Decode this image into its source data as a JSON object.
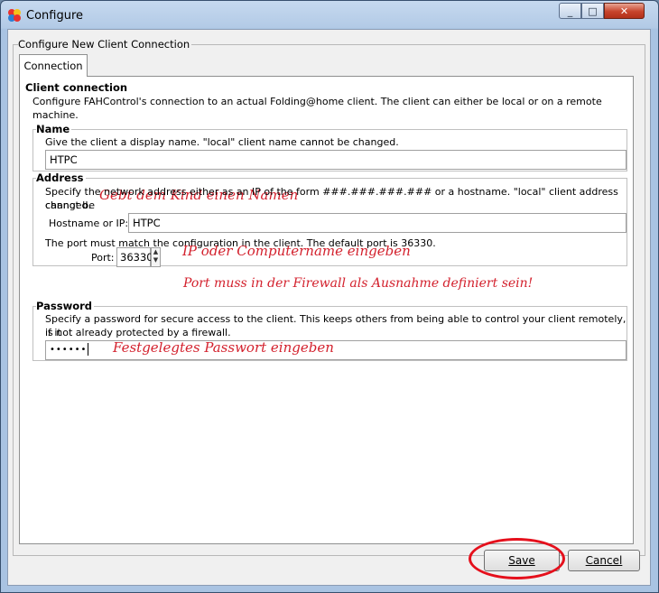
{
  "window": {
    "title": "Configure",
    "min_icon": "_",
    "max_icon": "□",
    "close_icon": "✕"
  },
  "group_title": "Configure New Client Connection",
  "tab": {
    "label": "Connection"
  },
  "client_connection": {
    "title": "Client connection",
    "desc_line1": "Configure FAHControl's connection to an actual Folding@home client.  The client can either be local or on a remote",
    "desc_line2": "machine."
  },
  "name_section": {
    "title": "Name",
    "desc": "Give the client a display name.  \"local\" client name cannot be changed.",
    "value": "HTPC",
    "annotation": "Gebt dem Kind einen Namen"
  },
  "address_section": {
    "title": "Address",
    "desc_line1": "Specify the network address either as an IP of the form ###.###.###.### or a hostname.  \"local\" client address cannot be",
    "desc_line2": "changed.",
    "host_label": "Hostname or IP:",
    "host_value": "HTPC",
    "host_annotation": "IP oder Computername eingeben",
    "port_desc": "The port must match the configuration in the client.  The default port is 36330.",
    "port_label": "Port:",
    "port_value": "36330",
    "port_annotation": "Port muss in der Firewall als Ausnahme definiert sein!"
  },
  "password_section": {
    "title": "Password",
    "desc_line1": "Specify a password for secure access to the client.  This keeps others from being able to control your client remotely, if it",
    "desc_line2": "is not already protected by a firewall.",
    "value": "••••••",
    "annotation": "Festgelegtes Passwort eingeben"
  },
  "buttons": {
    "save": "Save",
    "cancel": "Cancel"
  },
  "colors": {
    "annotation": "#d3212d",
    "highlight_ellipse": "#e5101c",
    "title_bar": "#b2cae6"
  }
}
